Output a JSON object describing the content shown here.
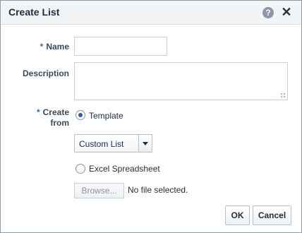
{
  "dialog": {
    "title": "Create List",
    "help_icon": "?",
    "close_icon": "✕"
  },
  "form": {
    "name_label": "Name",
    "description_label": "Description",
    "create_from_label_line1": "Create",
    "create_from_label_line2": "from",
    "required_mark": "*",
    "template_option": "Template",
    "template_select_value": "Custom List",
    "excel_option": "Excel Spreadsheet",
    "browse_label": "Browse...",
    "no_file_text": "No file selected."
  },
  "buttons": {
    "ok": "OK",
    "cancel": "Cancel"
  },
  "icons": {
    "help": "help-icon",
    "close": "close-icon",
    "dropdown": "chevron-down-icon"
  }
}
